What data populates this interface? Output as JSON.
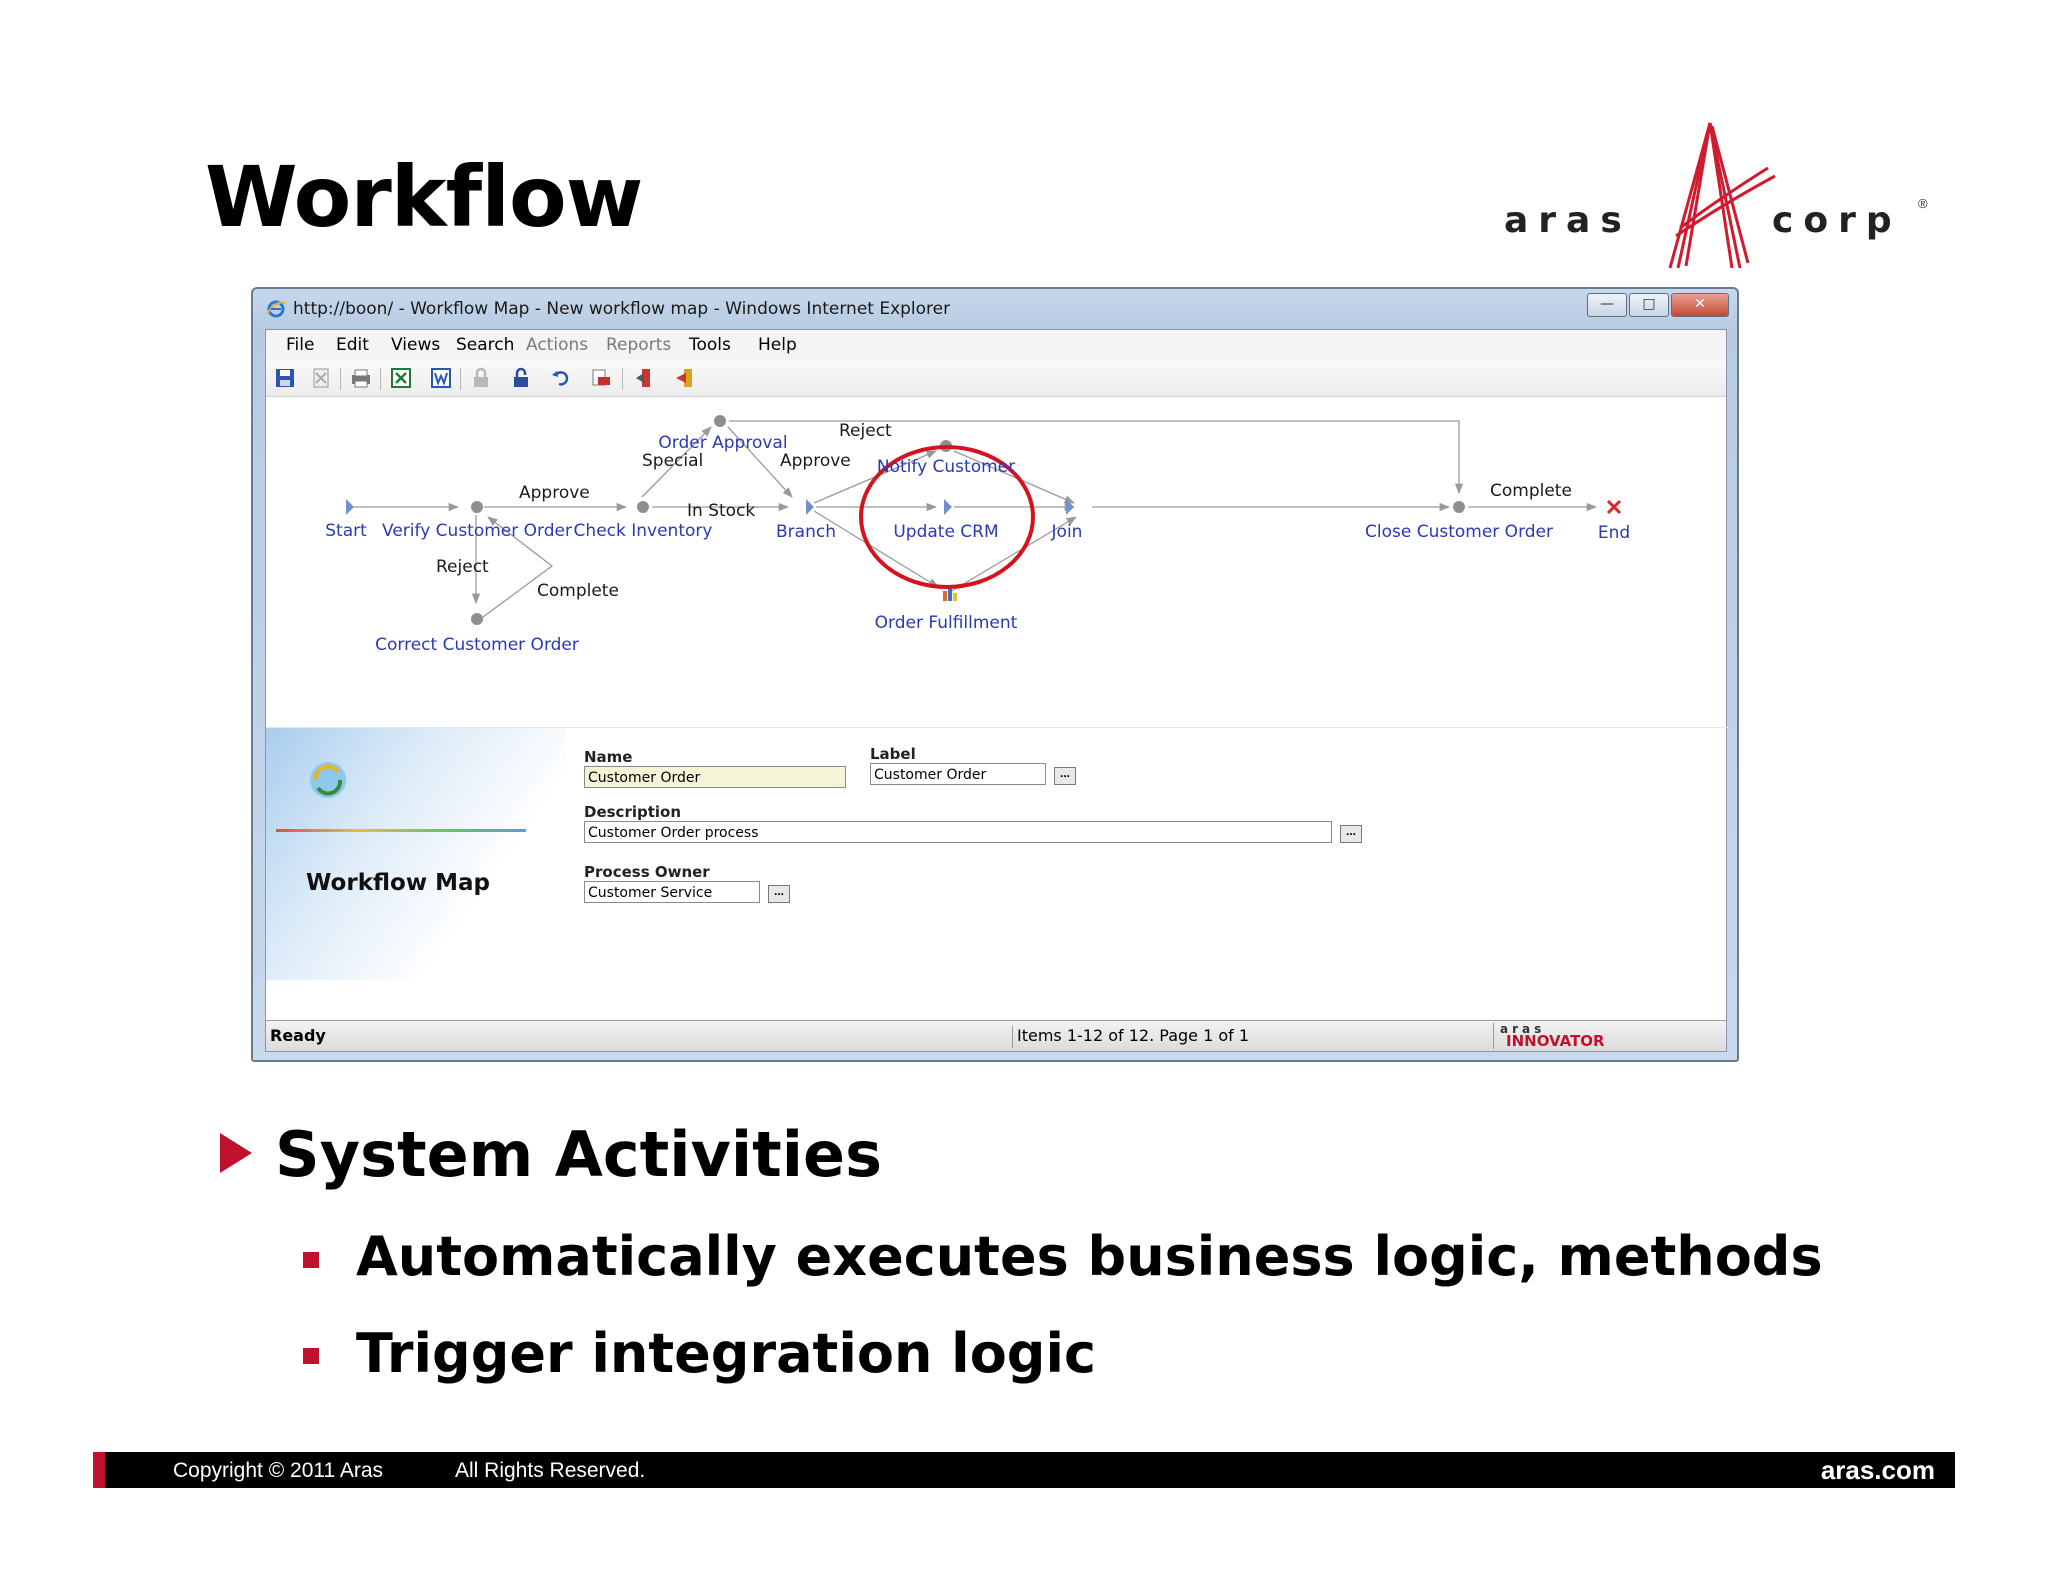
{
  "slide": {
    "title": "Workflow",
    "logo_left": "aras",
    "logo_right": "corp",
    "logo_reg": "®"
  },
  "browser": {
    "title": "http://boon/ - Workflow Map - New workflow map - Windows Internet Explorer",
    "menu": [
      "File",
      "Edit",
      "Views",
      "Search",
      "Actions",
      "Reports",
      "Tools",
      "Help"
    ],
    "toolbar_icons": [
      "save-icon",
      "discard-icon",
      "print-icon",
      "excel-icon",
      "word-icon",
      "lock-icon",
      "unlock-icon",
      "undo-icon",
      "export-icon",
      "claim-icon",
      "promote-icon"
    ]
  },
  "workflow": {
    "nodes": {
      "start": "Start",
      "verify": "Verify Customer Order",
      "check": "Check Inventory",
      "approval": "Order Approval",
      "branch": "Branch",
      "notify": "Notify Customer",
      "update": "Update CRM",
      "fulfill": "Order Fulfillment",
      "join": "Join",
      "close": "Close Customer Order",
      "end": "End",
      "correct": "Correct Customer Order"
    },
    "edges": {
      "approve1": "Approve",
      "reject1": "Reject",
      "complete1": "Complete",
      "special": "Special",
      "instock": "In Stock",
      "approve2": "Approve",
      "reject2": "Reject",
      "complete2": "Complete"
    },
    "highlight_color": "#d3141f"
  },
  "form": {
    "panel_title": "Workflow Map",
    "name_label": "Name",
    "name_value": "Customer Order",
    "label_label": "Label",
    "label_value": "Customer Order",
    "description_label": "Description",
    "description_value": "Customer Order process",
    "owner_label": "Process Owner",
    "owner_value": "Customer Service",
    "ellipsis": "..."
  },
  "status": {
    "ready": "Ready",
    "items": "Items 1-12 of 12. Page 1 of 1",
    "brand_top": "aras",
    "brand_bottom": "INNOVATOR"
  },
  "bullets": {
    "main": "System Activities",
    "sub1": "Automatically executes business logic, methods",
    "sub2": "Trigger integration logic"
  },
  "footer": {
    "copyright": "Copyright © 2011 Aras",
    "rights": "All Rights Reserved.",
    "site": "aras.com"
  },
  "colors": {
    "accent": "#c0112e",
    "link_blue": "#2a39b8"
  }
}
